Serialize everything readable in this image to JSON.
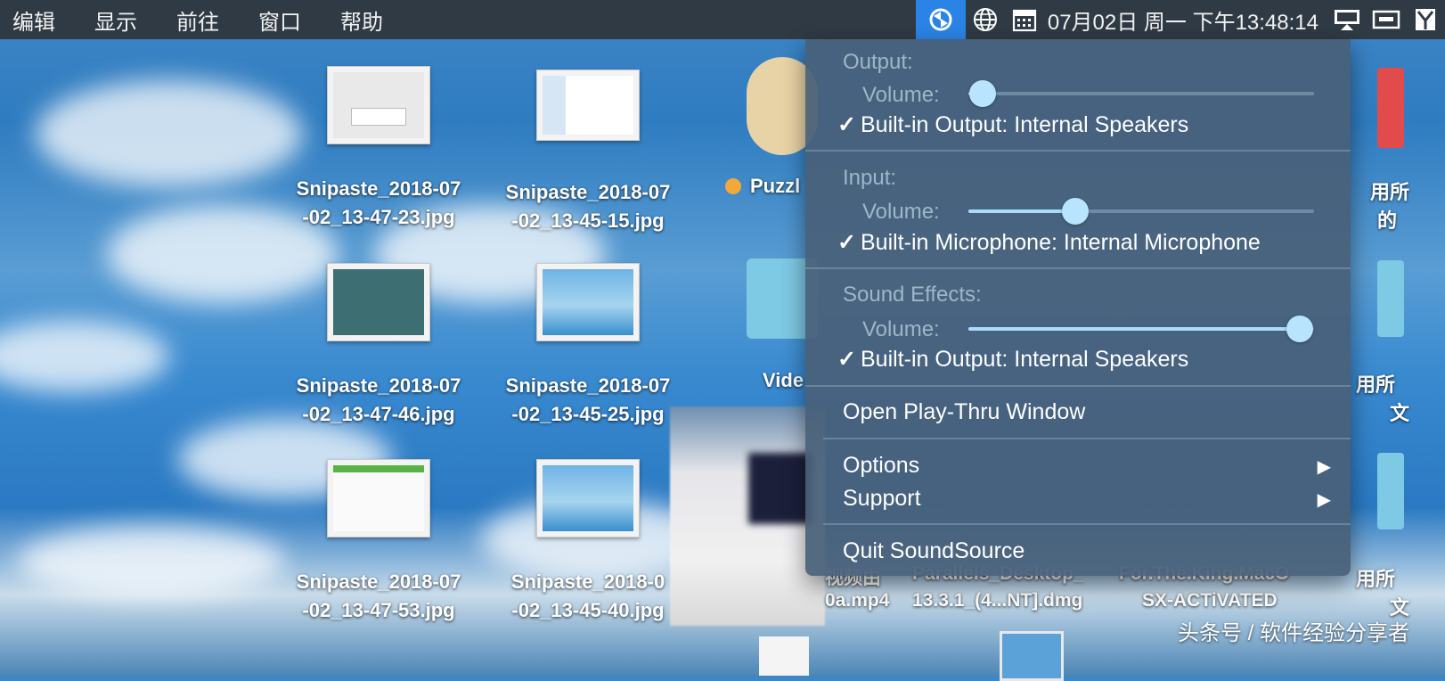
{
  "menubar": {
    "items": [
      "编辑",
      "显示",
      "前往",
      "窗口",
      "帮助"
    ],
    "clock": "07月02日 周一 下午13:48:14"
  },
  "desktop": {
    "files": [
      {
        "name_line1": "Snipaste_2018-07",
        "name_line2": "-02_13-47-23.jpg"
      },
      {
        "name_line1": "Snipaste_2018-07",
        "name_line2": "-02_13-45-15.jpg"
      },
      {
        "name_line1": "Snipaste_2018-07",
        "name_line2": "-02_13-47-46.jpg"
      },
      {
        "name_line1": "Snipaste_2018-07",
        "name_line2": "-02_13-45-25.jpg"
      },
      {
        "name_line1": "Snipaste_2018-07",
        "name_line2": "-02_13-47-53.jpg"
      },
      {
        "name_line1": "Snipaste_2018-0",
        "name_line2": "-02_13-45-40.jpg"
      }
    ],
    "partial_labels": {
      "puzzle": "Puzzl",
      "video": "Vide",
      "right_1": "用所",
      "right_1b": "的",
      "right_2": "用所",
      "right_2b": "文",
      "right_3": "用所",
      "right_3b": "文"
    },
    "bottom_labels": {
      "mp4_line1": "视频由",
      "mp4_line2": "0a.mp4",
      "dmg_line1": "Parallels_Desktop_",
      "dmg_line2": "13.3.1_(4...NT].dmg",
      "activated_line1": "For.The.King.MacO",
      "activated_line2": "SX-ACTiVATED"
    },
    "watermark": "头条号 / 软件经验分享者"
  },
  "sound_menu": {
    "output": {
      "title": "Output:",
      "volume_label": "Volume:",
      "volume_level": 0.04,
      "device": "Built-in Output: Internal Speakers",
      "check": "✓"
    },
    "input": {
      "title": "Input:",
      "volume_label": "Volume:",
      "volume_level": 0.31,
      "device": "Built-in Microphone: Internal Microphone",
      "check": "✓"
    },
    "effects": {
      "title": "Sound Effects:",
      "volume_label": "Volume:",
      "volume_level": 0.96,
      "device": "Built-in Output: Internal Speakers",
      "check": "✓"
    },
    "actions": {
      "play_thru": "Open Play-Thru Window",
      "options": "Options",
      "support": "Support",
      "quit": "Quit SoundSource",
      "submenu_arrow": "▶"
    }
  },
  "colors": {
    "menubar_bg": "#2f3a44",
    "tray_active": "#2a84e6",
    "menu_bg": "#486078",
    "slider_fill": "#a9dcfb"
  },
  "icons": {
    "tray": [
      "soundsource-icon",
      "globe-icon",
      "calendar-icon",
      "display-icon",
      "shortcut-icon",
      "app-icon"
    ]
  }
}
